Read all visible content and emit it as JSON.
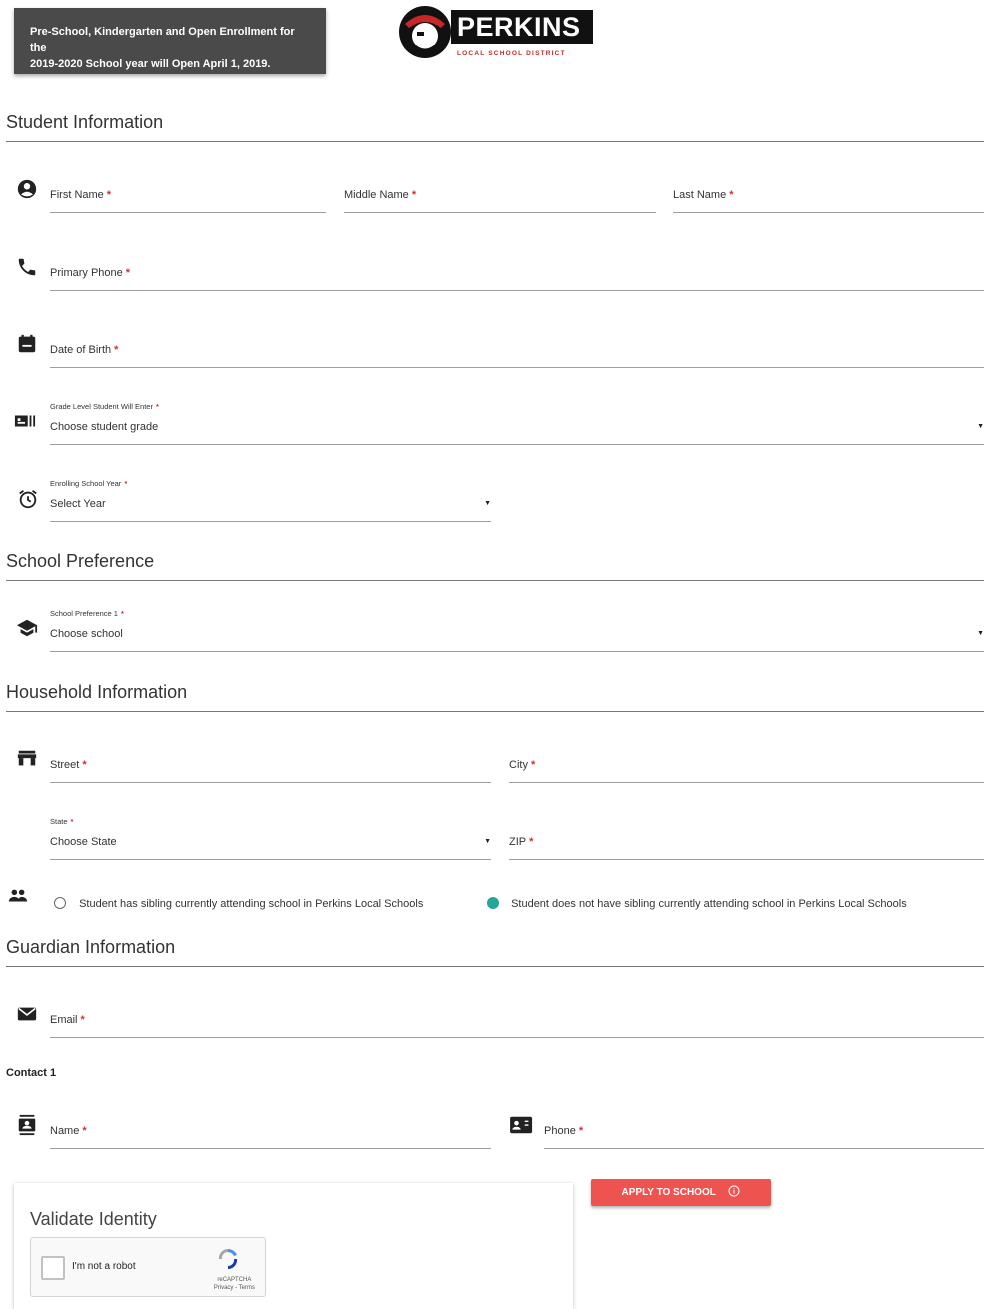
{
  "banner": {
    "line1": "Pre-School, Kindergarten and Open Enrollment for the",
    "line2": "2019-2020 School year will Open April 1, 2019."
  },
  "logo": {
    "name": "PERKINS",
    "subtitle": "LOCAL SCHOOL DISTRICT"
  },
  "sections": {
    "student": "Student Information",
    "school": "School Preference",
    "household": "Household Information",
    "guardian": "Guardian Information"
  },
  "student": {
    "first_name": "First Name",
    "middle_name": "Middle Name",
    "last_name": "Last Name",
    "primary_phone": "Primary Phone",
    "dob": "Date of Birth",
    "grade": {
      "label": "Grade Level Student Will Enter",
      "value": "Choose student grade"
    },
    "year": {
      "label": "Enrolling School Year",
      "value": "Select Year"
    }
  },
  "school": {
    "pref1": {
      "label": "School Preference 1",
      "value": "Choose school"
    }
  },
  "household": {
    "street": "Street",
    "city": "City",
    "state": {
      "label": "State",
      "value": "Choose State"
    },
    "zip": "ZIP",
    "sibling_yes": "Student has sibling currently attending school in Perkins Local Schools",
    "sibling_no": "Student does not have sibling currently attending school in Perkins Local Schools"
  },
  "guardian": {
    "email": "Email",
    "contact_label": "Contact 1",
    "name": "Name",
    "phone": "Phone"
  },
  "required_mark": "*",
  "validate": {
    "title": "Validate Identity",
    "robot_label": "I'm not a robot",
    "brand": "reCAPTCHA",
    "links": "Privacy - Terms"
  },
  "apply_button": {
    "label": "APPLY TO SCHOOL",
    "icon": "info-circle-icon"
  },
  "colors": {
    "banner_bg": "#4a4a4a",
    "required": "#d32f2f",
    "radio_selected": "#26a69a",
    "apply_bg": "#ef5350"
  }
}
